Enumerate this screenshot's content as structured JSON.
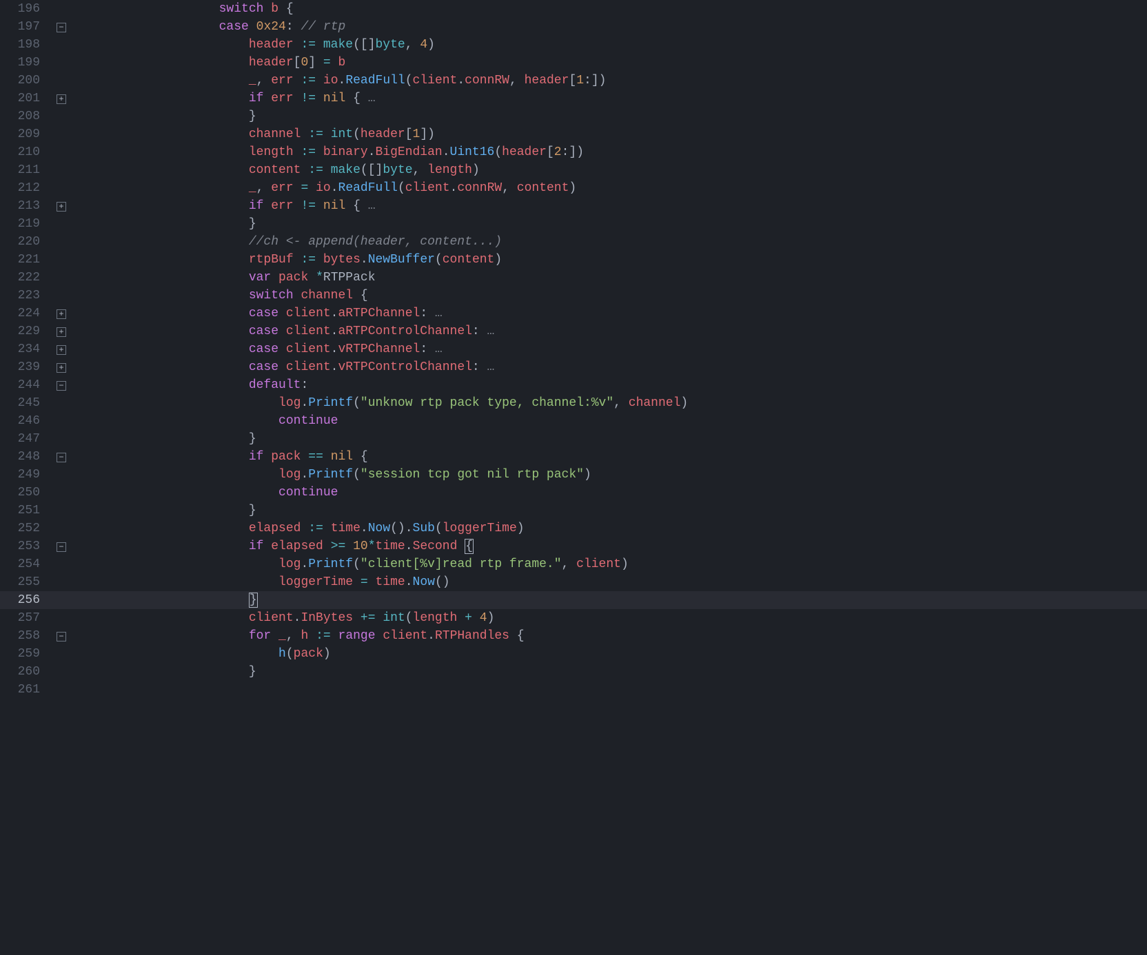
{
  "lines": [
    {
      "num": "196",
      "fold": "",
      "guides": 3,
      "tokens": [
        [
          "kw",
          "switch"
        ],
        [
          "punc",
          " "
        ],
        [
          "ident",
          "b"
        ],
        [
          "punc",
          " {"
        ]
      ]
    },
    {
      "num": "197",
      "fold": "minus",
      "guides": 3,
      "tokens": [
        [
          "kw",
          "case"
        ],
        [
          "punc",
          " "
        ],
        [
          "num",
          "0x24"
        ],
        [
          "punc",
          ": "
        ],
        [
          "cmt",
          "// rtp"
        ]
      ]
    },
    {
      "num": "198",
      "fold": "",
      "guides": 4,
      "tokens": [
        [
          "ident",
          "header"
        ],
        [
          "punc",
          " "
        ],
        [
          "op",
          ":="
        ],
        [
          "punc",
          " "
        ],
        [
          "type",
          "make"
        ],
        [
          "punc",
          "([]"
        ],
        [
          "type",
          "byte"
        ],
        [
          "punc",
          ", "
        ],
        [
          "num",
          "4"
        ],
        [
          "punc",
          ")"
        ]
      ]
    },
    {
      "num": "199",
      "fold": "",
      "guides": 4,
      "tokens": [
        [
          "ident",
          "header"
        ],
        [
          "punc",
          "["
        ],
        [
          "num",
          "0"
        ],
        [
          "punc",
          "] "
        ],
        [
          "op",
          "="
        ],
        [
          "punc",
          " "
        ],
        [
          "ident",
          "b"
        ]
      ]
    },
    {
      "num": "200",
      "fold": "",
      "guides": 4,
      "tokens": [
        [
          "ident",
          "_"
        ],
        [
          "punc",
          ", "
        ],
        [
          "ident",
          "err"
        ],
        [
          "punc",
          " "
        ],
        [
          "op",
          ":="
        ],
        [
          "punc",
          " "
        ],
        [
          "ident",
          "io"
        ],
        [
          "punc",
          "."
        ],
        [
          "fn",
          "ReadFull"
        ],
        [
          "punc",
          "("
        ],
        [
          "ident",
          "client"
        ],
        [
          "punc",
          "."
        ],
        [
          "ident",
          "connRW"
        ],
        [
          "punc",
          ", "
        ],
        [
          "ident",
          "header"
        ],
        [
          "punc",
          "["
        ],
        [
          "num",
          "1"
        ],
        [
          "punc",
          ":])"
        ]
      ]
    },
    {
      "num": "201",
      "fold": "plus",
      "guides": 4,
      "tokens": [
        [
          "kw",
          "if"
        ],
        [
          "punc",
          " "
        ],
        [
          "ident",
          "err"
        ],
        [
          "punc",
          " "
        ],
        [
          "op",
          "!="
        ],
        [
          "punc",
          " "
        ],
        [
          "num",
          "nil"
        ],
        [
          "punc",
          " {"
        ],
        [
          "ellip",
          "…"
        ]
      ]
    },
    {
      "num": "208",
      "fold": "",
      "guides": 4,
      "tokens": [
        [
          "punc",
          "}"
        ]
      ]
    },
    {
      "num": "209",
      "fold": "",
      "guides": 4,
      "tokens": [
        [
          "ident",
          "channel"
        ],
        [
          "punc",
          " "
        ],
        [
          "op",
          ":="
        ],
        [
          "punc",
          " "
        ],
        [
          "type",
          "int"
        ],
        [
          "punc",
          "("
        ],
        [
          "ident",
          "header"
        ],
        [
          "punc",
          "["
        ],
        [
          "num",
          "1"
        ],
        [
          "punc",
          "])"
        ]
      ]
    },
    {
      "num": "210",
      "fold": "",
      "guides": 4,
      "tokens": [
        [
          "ident",
          "length"
        ],
        [
          "punc",
          " "
        ],
        [
          "op",
          ":="
        ],
        [
          "punc",
          " "
        ],
        [
          "ident",
          "binary"
        ],
        [
          "punc",
          "."
        ],
        [
          "ident",
          "BigEndian"
        ],
        [
          "punc",
          "."
        ],
        [
          "fn",
          "Uint16"
        ],
        [
          "punc",
          "("
        ],
        [
          "ident",
          "header"
        ],
        [
          "punc",
          "["
        ],
        [
          "num",
          "2"
        ],
        [
          "punc",
          ":])"
        ]
      ]
    },
    {
      "num": "211",
      "fold": "",
      "guides": 4,
      "tokens": [
        [
          "ident",
          "content"
        ],
        [
          "punc",
          " "
        ],
        [
          "op",
          ":="
        ],
        [
          "punc",
          " "
        ],
        [
          "type",
          "make"
        ],
        [
          "punc",
          "([]"
        ],
        [
          "type",
          "byte"
        ],
        [
          "punc",
          ", "
        ],
        [
          "ident",
          "length"
        ],
        [
          "punc",
          ")"
        ]
      ]
    },
    {
      "num": "212",
      "fold": "",
      "guides": 4,
      "tokens": [
        [
          "ident",
          "_"
        ],
        [
          "punc",
          ", "
        ],
        [
          "ident",
          "err"
        ],
        [
          "punc",
          " "
        ],
        [
          "op",
          "="
        ],
        [
          "punc",
          " "
        ],
        [
          "ident",
          "io"
        ],
        [
          "punc",
          "."
        ],
        [
          "fn",
          "ReadFull"
        ],
        [
          "punc",
          "("
        ],
        [
          "ident",
          "client"
        ],
        [
          "punc",
          "."
        ],
        [
          "ident",
          "connRW"
        ],
        [
          "punc",
          ", "
        ],
        [
          "ident",
          "content"
        ],
        [
          "punc",
          ")"
        ]
      ]
    },
    {
      "num": "213",
      "fold": "plus",
      "guides": 4,
      "tokens": [
        [
          "kw",
          "if"
        ],
        [
          "punc",
          " "
        ],
        [
          "ident",
          "err"
        ],
        [
          "punc",
          " "
        ],
        [
          "op",
          "!="
        ],
        [
          "punc",
          " "
        ],
        [
          "num",
          "nil"
        ],
        [
          "punc",
          " {"
        ],
        [
          "ellip",
          "…"
        ]
      ]
    },
    {
      "num": "219",
      "fold": "",
      "guides": 4,
      "tokens": [
        [
          "punc",
          "}"
        ]
      ]
    },
    {
      "num": "220",
      "fold": "",
      "guides": 4,
      "tokens": [
        [
          "cmt",
          "//ch <- append(header, content...)"
        ]
      ]
    },
    {
      "num": "221",
      "fold": "",
      "guides": 4,
      "tokens": [
        [
          "ident",
          "rtpBuf"
        ],
        [
          "punc",
          " "
        ],
        [
          "op",
          ":="
        ],
        [
          "punc",
          " "
        ],
        [
          "ident",
          "bytes"
        ],
        [
          "punc",
          "."
        ],
        [
          "fn",
          "NewBuffer"
        ],
        [
          "punc",
          "("
        ],
        [
          "ident",
          "content"
        ],
        [
          "punc",
          ")"
        ]
      ]
    },
    {
      "num": "222",
      "fold": "",
      "guides": 4,
      "tokens": [
        [
          "kw",
          "var"
        ],
        [
          "punc",
          " "
        ],
        [
          "ident",
          "pack"
        ],
        [
          "punc",
          " "
        ],
        [
          "op",
          "*"
        ],
        [
          "identLight",
          "RTPPack"
        ]
      ]
    },
    {
      "num": "223",
      "fold": "",
      "guides": 4,
      "tokens": [
        [
          "kw",
          "switch"
        ],
        [
          "punc",
          " "
        ],
        [
          "ident",
          "channel"
        ],
        [
          "punc",
          " {"
        ]
      ]
    },
    {
      "num": "224",
      "fold": "plus",
      "guides": 4,
      "tokens": [
        [
          "kw",
          "case"
        ],
        [
          "punc",
          " "
        ],
        [
          "ident",
          "client"
        ],
        [
          "punc",
          "."
        ],
        [
          "ident",
          "aRTPChannel"
        ],
        [
          "punc",
          ":"
        ],
        [
          "ellip",
          "…"
        ]
      ]
    },
    {
      "num": "229",
      "fold": "plus",
      "guides": 4,
      "tokens": [
        [
          "kw",
          "case"
        ],
        [
          "punc",
          " "
        ],
        [
          "ident",
          "client"
        ],
        [
          "punc",
          "."
        ],
        [
          "ident",
          "aRTPControlChannel"
        ],
        [
          "punc",
          ":"
        ],
        [
          "ellip",
          "…"
        ]
      ]
    },
    {
      "num": "234",
      "fold": "plus",
      "guides": 4,
      "tokens": [
        [
          "kw",
          "case"
        ],
        [
          "punc",
          " "
        ],
        [
          "ident",
          "client"
        ],
        [
          "punc",
          "."
        ],
        [
          "ident",
          "vRTPChannel"
        ],
        [
          "punc",
          ":"
        ],
        [
          "ellip",
          "…"
        ]
      ]
    },
    {
      "num": "239",
      "fold": "plus",
      "guides": 4,
      "tokens": [
        [
          "kw",
          "case"
        ],
        [
          "punc",
          " "
        ],
        [
          "ident",
          "client"
        ],
        [
          "punc",
          "."
        ],
        [
          "ident",
          "vRTPControlChannel"
        ],
        [
          "punc",
          ":"
        ],
        [
          "ellip",
          "…"
        ]
      ]
    },
    {
      "num": "244",
      "fold": "minus",
      "guides": 4,
      "tokens": [
        [
          "kw",
          "default"
        ],
        [
          "punc",
          ":"
        ]
      ]
    },
    {
      "num": "245",
      "fold": "",
      "guides": 5,
      "tokens": [
        [
          "ident",
          "log"
        ],
        [
          "punc",
          "."
        ],
        [
          "fn",
          "Printf"
        ],
        [
          "punc",
          "("
        ],
        [
          "str",
          "\"unknow rtp pack type, channel:%v\""
        ],
        [
          "punc",
          ", "
        ],
        [
          "ident",
          "channel"
        ],
        [
          "punc",
          ")"
        ]
      ]
    },
    {
      "num": "246",
      "fold": "",
      "guides": 5,
      "tokens": [
        [
          "kw",
          "continue"
        ]
      ]
    },
    {
      "num": "247",
      "fold": "",
      "guides": 4,
      "tokens": [
        [
          "punc",
          "}"
        ]
      ]
    },
    {
      "num": "248",
      "fold": "minus",
      "guides": 4,
      "tokens": [
        [
          "kw",
          "if"
        ],
        [
          "punc",
          " "
        ],
        [
          "ident",
          "pack"
        ],
        [
          "punc",
          " "
        ],
        [
          "op",
          "=="
        ],
        [
          "punc",
          " "
        ],
        [
          "num",
          "nil"
        ],
        [
          "punc",
          " {"
        ]
      ]
    },
    {
      "num": "249",
      "fold": "",
      "guides": 5,
      "tokens": [
        [
          "ident",
          "log"
        ],
        [
          "punc",
          "."
        ],
        [
          "fn",
          "Printf"
        ],
        [
          "punc",
          "("
        ],
        [
          "str",
          "\"session tcp got nil rtp pack\""
        ],
        [
          "punc",
          ")"
        ]
      ]
    },
    {
      "num": "250",
      "fold": "",
      "guides": 5,
      "tokens": [
        [
          "kw",
          "continue"
        ]
      ]
    },
    {
      "num": "251",
      "fold": "",
      "guides": 4,
      "tokens": [
        [
          "punc",
          "}"
        ]
      ]
    },
    {
      "num": "252",
      "fold": "",
      "guides": 4,
      "tokens": [
        [
          "ident",
          "elapsed"
        ],
        [
          "punc",
          " "
        ],
        [
          "op",
          ":="
        ],
        [
          "punc",
          " "
        ],
        [
          "ident",
          "time"
        ],
        [
          "punc",
          "."
        ],
        [
          "fn",
          "Now"
        ],
        [
          "punc",
          "()."
        ],
        [
          "fn",
          "Sub"
        ],
        [
          "punc",
          "("
        ],
        [
          "ident",
          "loggerTime"
        ],
        [
          "punc",
          ")"
        ]
      ]
    },
    {
      "num": "253",
      "fold": "minus",
      "guides": 4,
      "tokens": [
        [
          "kw",
          "if"
        ],
        [
          "punc",
          " "
        ],
        [
          "ident",
          "elapsed"
        ],
        [
          "punc",
          " "
        ],
        [
          "op",
          ">="
        ],
        [
          "punc",
          " "
        ],
        [
          "num",
          "10"
        ],
        [
          "op",
          "*"
        ],
        [
          "ident",
          "time"
        ],
        [
          "punc",
          "."
        ],
        [
          "ident",
          "Second"
        ],
        [
          "punc",
          " "
        ],
        [
          "cursor",
          "{"
        ]
      ]
    },
    {
      "num": "254",
      "fold": "",
      "guides": 5,
      "tokens": [
        [
          "ident",
          "log"
        ],
        [
          "punc",
          "."
        ],
        [
          "fn",
          "Printf"
        ],
        [
          "punc",
          "("
        ],
        [
          "str",
          "\"client[%v]read rtp frame.\""
        ],
        [
          "punc",
          ", "
        ],
        [
          "ident",
          "client"
        ],
        [
          "punc",
          ")"
        ]
      ]
    },
    {
      "num": "255",
      "fold": "",
      "guides": 5,
      "tokens": [
        [
          "ident",
          "loggerTime"
        ],
        [
          "punc",
          " "
        ],
        [
          "op",
          "="
        ],
        [
          "punc",
          " "
        ],
        [
          "ident",
          "time"
        ],
        [
          "punc",
          "."
        ],
        [
          "fn",
          "Now"
        ],
        [
          "punc",
          "()"
        ]
      ]
    },
    {
      "num": "256",
      "fold": "",
      "guides": 4,
      "active": true,
      "tokens": [
        [
          "cursor",
          "}"
        ]
      ]
    },
    {
      "num": "257",
      "fold": "",
      "guides": 4,
      "tokens": [
        [
          "ident",
          "client"
        ],
        [
          "punc",
          "."
        ],
        [
          "ident",
          "InBytes"
        ],
        [
          "punc",
          " "
        ],
        [
          "op",
          "+="
        ],
        [
          "punc",
          " "
        ],
        [
          "type",
          "int"
        ],
        [
          "punc",
          "("
        ],
        [
          "ident",
          "length"
        ],
        [
          "punc",
          " "
        ],
        [
          "op",
          "+"
        ],
        [
          "punc",
          " "
        ],
        [
          "num",
          "4"
        ],
        [
          "punc",
          ")"
        ]
      ]
    },
    {
      "num": "258",
      "fold": "minus",
      "guides": 4,
      "tokens": [
        [
          "kw",
          "for"
        ],
        [
          "punc",
          " "
        ],
        [
          "ident",
          "_"
        ],
        [
          "punc",
          ", "
        ],
        [
          "ident",
          "h"
        ],
        [
          "punc",
          " "
        ],
        [
          "op",
          ":="
        ],
        [
          "punc",
          " "
        ],
        [
          "kw",
          "range"
        ],
        [
          "punc",
          " "
        ],
        [
          "ident",
          "client"
        ],
        [
          "punc",
          "."
        ],
        [
          "ident",
          "RTPHandles"
        ],
        [
          "punc",
          " {"
        ]
      ]
    },
    {
      "num": "259",
      "fold": "",
      "guides": 5,
      "tokens": [
        [
          "fn",
          "h"
        ],
        [
          "punc",
          "("
        ],
        [
          "ident",
          "pack"
        ],
        [
          "punc",
          ")"
        ]
      ]
    },
    {
      "num": "260",
      "fold": "",
      "guides": 4,
      "tokens": [
        [
          "punc",
          "}"
        ]
      ]
    },
    {
      "num": "261",
      "fold": "",
      "guides": 3,
      "tokens": []
    }
  ],
  "foldGlyphs": {
    "plus": "+",
    "minus": "−"
  }
}
